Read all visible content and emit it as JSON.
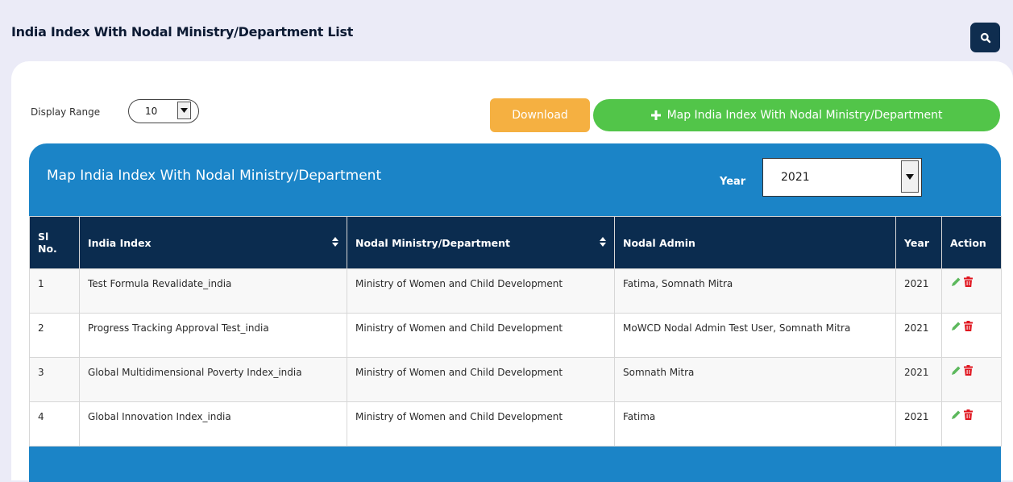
{
  "page": {
    "title": "India Index With Nodal Ministry/Department List",
    "search_icon": "search-icon"
  },
  "toolbar": {
    "display_range_label": "Display Range",
    "display_range_value": "10",
    "download_label": "Download",
    "map_button_label": "Map India Index With Nodal Ministry/Department",
    "map_button_icon": "plus-icon"
  },
  "panel": {
    "title": "Map India Index With Nodal Ministry/Department",
    "year_label": "Year",
    "year_value": "2021"
  },
  "table": {
    "headers": {
      "sl_no": "Sl No.",
      "india_index": "India Index",
      "nodal_ministry": "Nodal Ministry/Department",
      "nodal_admin": "Nodal Admin",
      "year": "Year",
      "action": "Action"
    },
    "rows": [
      {
        "sl": "1",
        "india_index": "Test Formula Revalidate_india",
        "ministry": "Ministry of Women and Child Development",
        "admin": "Fatima, Somnath Mitra",
        "year": "2021"
      },
      {
        "sl": "2",
        "india_index": "Progress Tracking Approval Test_india",
        "ministry": "Ministry of Women and Child Development",
        "admin": "MoWCD Nodal Admin Test User, Somnath Mitra",
        "year": "2021"
      },
      {
        "sl": "3",
        "india_index": "Global Multidimensional Poverty Index_india",
        "ministry": "Ministry of Women and Child Development",
        "admin": "Somnath Mitra",
        "year": "2021"
      },
      {
        "sl": "4",
        "india_index": "Global Innovation Index_india",
        "ministry": "Ministry of Women and Child Development",
        "admin": "Fatima",
        "year": "2021"
      }
    ]
  },
  "colors": {
    "header_bg": "#0b2c4f",
    "panel_bg": "#1b84c7",
    "download_bg": "#f5b041",
    "map_button_bg": "#52c549",
    "edit_icon": "#5cb85c",
    "delete_icon": "#e0141e"
  }
}
